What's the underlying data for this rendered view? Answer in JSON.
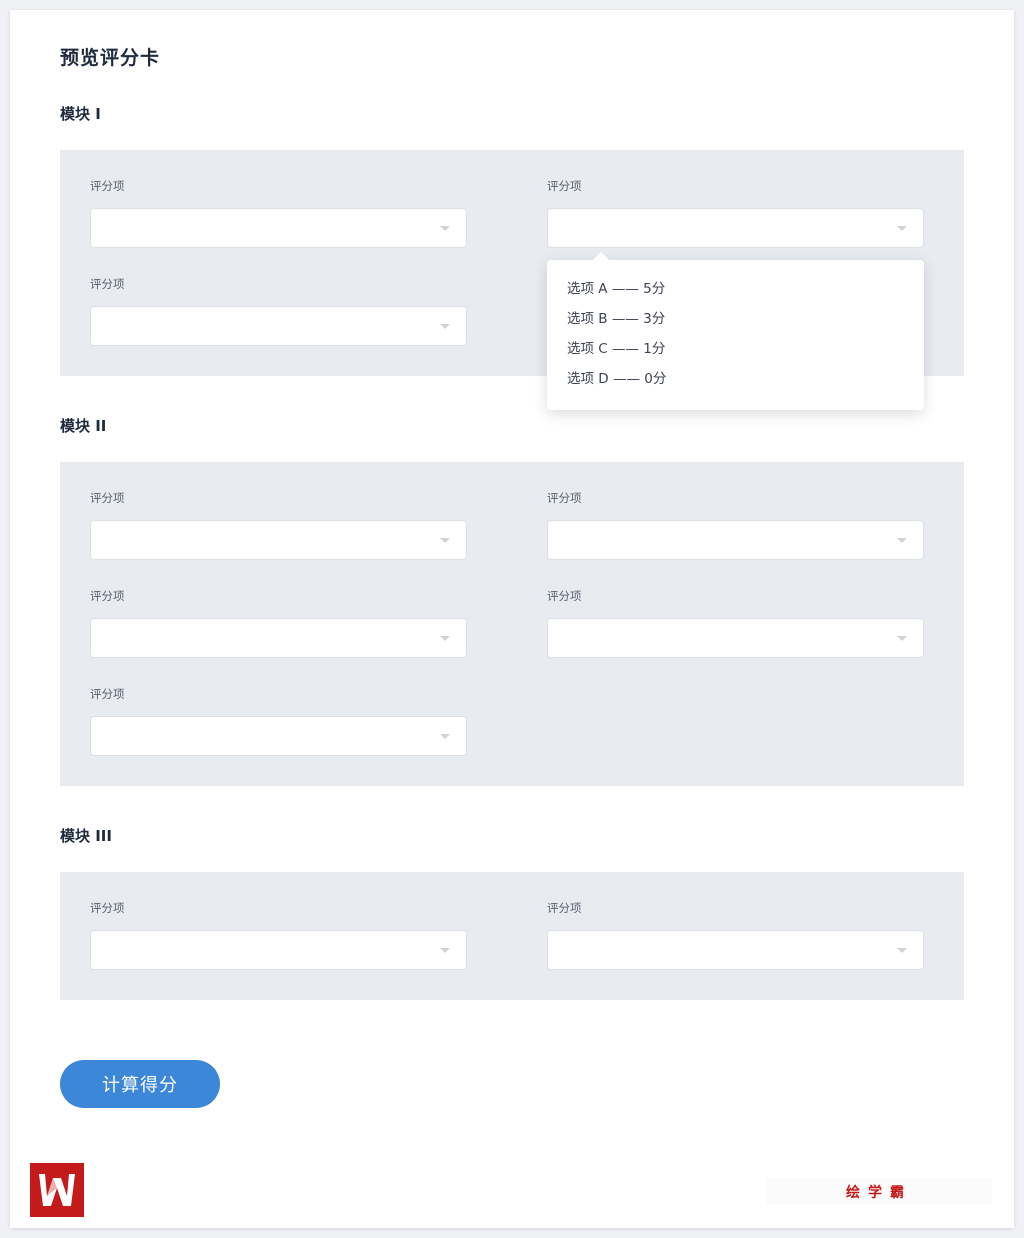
{
  "page": {
    "title": "预览评分卡"
  },
  "modules": [
    {
      "title": "模块 I",
      "field_label": "评分项"
    },
    {
      "title": "模块 II",
      "field_label": "评分项"
    },
    {
      "title": "模块 III",
      "field_label": "评分项"
    }
  ],
  "dropdown": {
    "options": [
      "选项 A —— 5分",
      "选项 B —— 3分",
      "选项 C —— 1分",
      "选项 D —— 0分"
    ]
  },
  "actions": {
    "calculate_label": "计算得分"
  },
  "footer": {
    "logo_icon": "brand-logo-icon",
    "watermark_text": "绘学霸"
  },
  "colors": {
    "accent": "#3d87d8",
    "module_background": "#e8ebf0",
    "brand_red": "#c41a1a"
  }
}
